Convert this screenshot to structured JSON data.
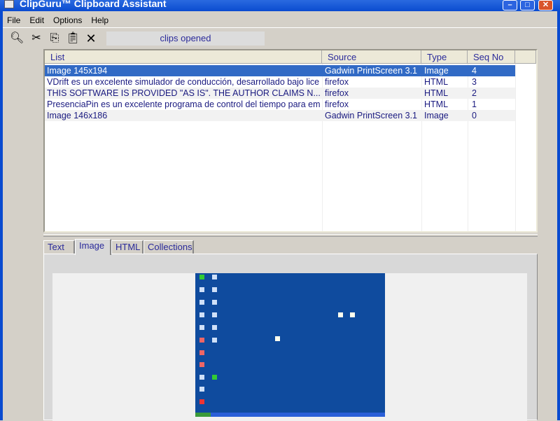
{
  "window": {
    "title": "ClipGuru™ Clipboard Assistant",
    "minimize": "–",
    "maximize": "□",
    "close": "✕"
  },
  "menu": [
    "File",
    "Edit",
    "Options",
    "Help"
  ],
  "toolbar": {
    "status": "clips opened",
    "buttons": [
      "search-icon",
      "cut-icon",
      "copy-icon",
      "paste-icon",
      "delete-icon"
    ]
  },
  "list": {
    "columns": [
      "List",
      "Source",
      "Type",
      "Seq No"
    ],
    "rows": [
      {
        "list": "Image 145x194",
        "source": "Gadwin PrintScreen 3.1",
        "type": "Image",
        "seq": "4",
        "selected": true
      },
      {
        "list": "VDrift es un excelente simulador de conducción, desarrollado bajo lice",
        "source": "firefox",
        "type": "HTML",
        "seq": "3"
      },
      {
        "list": "THIS SOFTWARE IS PROVIDED \"AS IS\". THE AUTHOR CLAIMS N...",
        "source": "firefox",
        "type": "HTML",
        "seq": "2"
      },
      {
        "list": "PresenciaPin es un excelente programa de control del tiempo para emple",
        "source": "firefox",
        "type": "HTML",
        "seq": "1"
      },
      {
        "list": "Image 146x186",
        "source": "Gadwin PrintScreen 3.1",
        "type": "Image",
        "seq": "0"
      }
    ]
  },
  "tabs": [
    {
      "label": "Text"
    },
    {
      "label": "Image",
      "active": true
    },
    {
      "label": "HTML"
    },
    {
      "label": "Collections"
    }
  ],
  "colors": {
    "title": "#0a4bd0",
    "selection": "#316ac5",
    "text": "#1a1a80",
    "desktop": "#0f4b9e"
  }
}
